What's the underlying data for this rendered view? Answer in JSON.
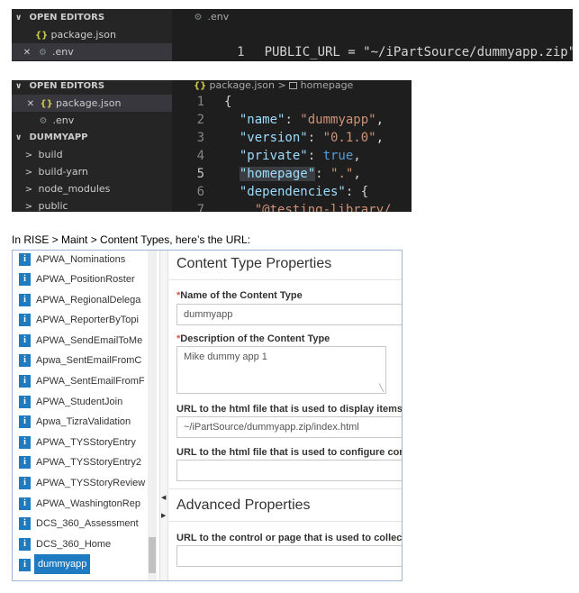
{
  "vscode_top": {
    "sidebar": {
      "section_title": "OPEN EDITORS",
      "items": [
        {
          "icon": "json-icon",
          "icon_glyph": "{}",
          "label": "package.json"
        },
        {
          "icon": "gear-icon",
          "icon_glyph": "⚙",
          "label": ".env"
        }
      ]
    },
    "editor": {
      "breadcrumb": ".env",
      "line_number": "1",
      "code": "PUBLIC_URL = \"~/iPartSource/dummyapp.zip\""
    }
  },
  "vscode_bottom": {
    "sidebar": {
      "open_editors_title": "OPEN EDITORS",
      "open_editors": [
        {
          "icon": "json-icon",
          "icon_glyph": "{}",
          "label": "package.json"
        },
        {
          "icon": "gear-icon",
          "icon_glyph": "⚙",
          "label": ".env"
        }
      ],
      "project_title": "DUMMYAPP",
      "folders": [
        "build",
        "build-yarn",
        "node_modules",
        "public"
      ]
    },
    "editor": {
      "breadcrumb_file": "package.json",
      "breadcrumb_sep": ">",
      "breadcrumb_symbol": "homepage",
      "line_numbers": [
        "1",
        "2",
        "3",
        "4",
        "5",
        "6",
        "7"
      ],
      "lines": {
        "l1_brace": "{",
        "l2_key": "\"name\"",
        "l2_val": "\"dummyapp\"",
        "l3_key": "\"version\"",
        "l3_val": "\"0.1.0\"",
        "l4_key": "\"private\"",
        "l4_val": "true",
        "l5_key": "\"homepage\"",
        "l5_val": "\".\"",
        "l6_key": "\"dependencies\"",
        "l6_brace": "{",
        "l7_key": "\"@testing-library/"
      }
    }
  },
  "caption": "In RISE > Maint > Content Types, here’s the URL:",
  "rise": {
    "list_items": [
      "APWA_Nominations",
      "APWA_PositionRoster",
      "APWA_RegionalDelega",
      "APWA_ReporterByTopi",
      "APWA_SendEmailToMe",
      "Apwa_SentEmailFromC",
      "APWA_SentEmailFromF",
      "APWA_StudentJoin",
      "Apwa_TizraValidation",
      "APWA_TYSStoryEntry",
      "APWA_TYSStoryEntry2",
      "APWA_TYSStoryReview",
      "APWA_WashingtonRep",
      "DCS_360_Assessment",
      "DCS_360_Home",
      "dummyapp"
    ],
    "selected_item": "dummyapp",
    "info_glyph": "i",
    "accent_color": "#1f7bc1",
    "form": {
      "section1_title": "Content Type Properties",
      "name_label": "Name of the Content Type",
      "name_value": "dummyapp",
      "desc_label": "Description of the Content Type",
      "desc_value": "Mike dummy app 1",
      "url_display_label": "URL to the html file that is used to display items",
      "url_display_value": "~/iPartSource/dummyapp.zip/index.html",
      "url_config_label": "URL to the html file that is used to configure cor",
      "url_config_value": "",
      "section2_title": "Advanced Properties",
      "url_control_label": "URL to the control or page that is used to collect",
      "url_control_value": "",
      "required_marker": "*"
    }
  }
}
